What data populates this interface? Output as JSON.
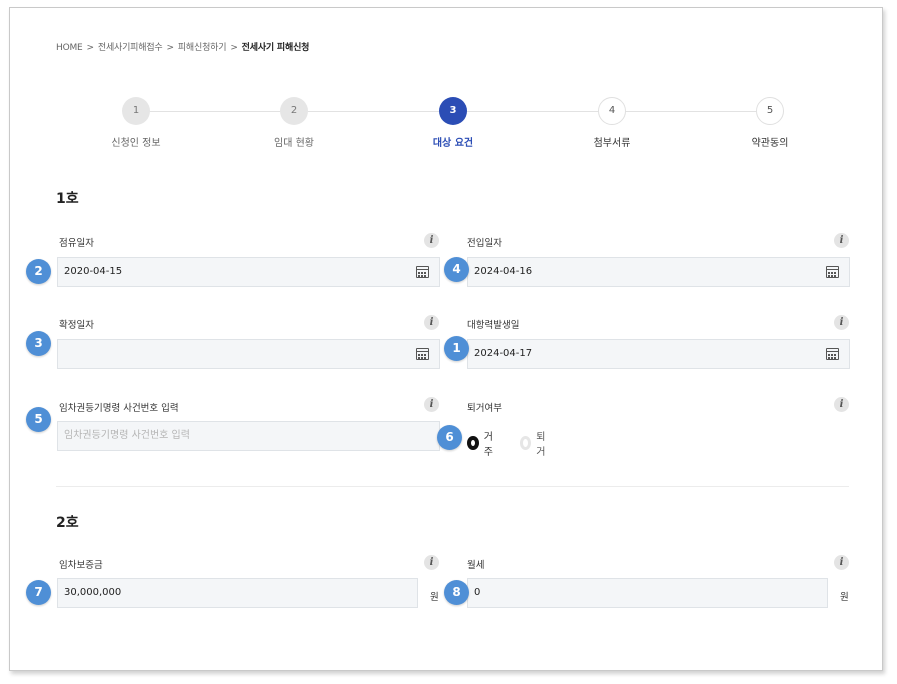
{
  "breadcrumb": {
    "items": [
      "HOME",
      ">",
      "전세사기피해접수",
      ">",
      "피해신청하기",
      ">"
    ],
    "current": "전세사기 피해신청"
  },
  "steps": [
    {
      "number": "1",
      "label": "신청인 정보",
      "state": "done"
    },
    {
      "number": "2",
      "label": "임대 현황",
      "state": "done"
    },
    {
      "number": "3",
      "label": "대상 요건",
      "state": "active"
    },
    {
      "number": "4",
      "label": "첨부서류",
      "state": "todo"
    },
    {
      "number": "5",
      "label": "약관동의",
      "state": "todo"
    }
  ],
  "section1": {
    "title": "1호",
    "occupancy_date": {
      "label": "점유일자",
      "value": "2020-04-15"
    },
    "move_in_date": {
      "label": "전입일자",
      "value": "2024-04-16"
    },
    "fixed_date": {
      "label": "확정일자",
      "value": ""
    },
    "opposing_power_date": {
      "label": "대항력발생일",
      "value": "2024-04-17"
    },
    "lease_registration": {
      "label": "임차권등기명령 사건번호 입력",
      "placeholder": "임차권등기명령 사건번호 입력"
    },
    "move_out": {
      "label": "퇴거여부",
      "options": [
        "거주",
        "퇴거"
      ],
      "selected": "거주"
    }
  },
  "section2": {
    "title": "2호",
    "deposit": {
      "label": "임차보증금",
      "value": "30,000,000",
      "unit": "원"
    },
    "monthly_rent": {
      "label": "월세",
      "value": "0",
      "unit": "원"
    }
  },
  "info_icon_glyph": "i",
  "badges": {
    "fixed_date": "3",
    "occupancy_date": "2",
    "move_in_date": "4",
    "opposing_power_date": "1",
    "lease_registration": "5",
    "move_out": "6",
    "deposit": "7",
    "monthly_rent": "8"
  },
  "colors": {
    "accent": "#2b4db5",
    "badge": "#4f8fd6",
    "input_bg": "#f4f6f8"
  }
}
